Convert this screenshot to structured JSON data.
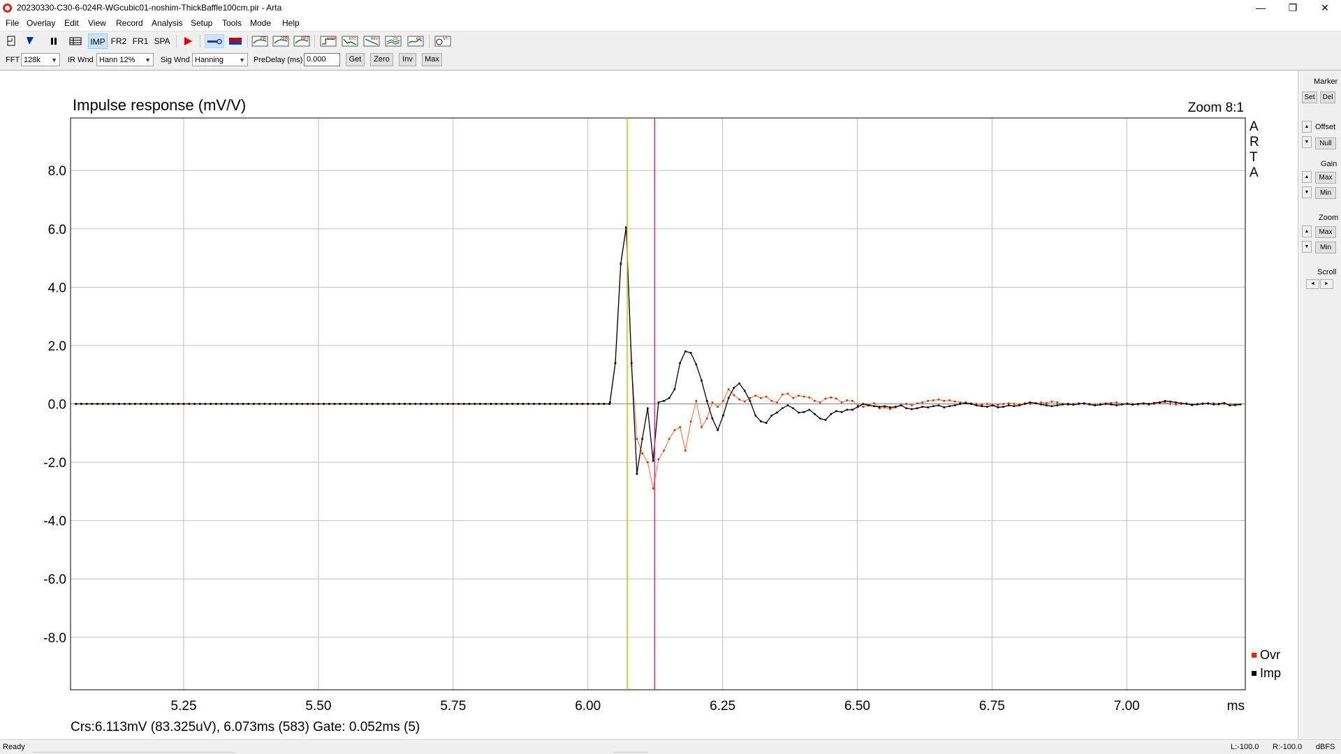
{
  "window": {
    "title": "20230330-C30-6-024R-WGcubic01-noshim-ThickBaffle100cm.pir - Arta",
    "minimize": "—",
    "maximize": "❐",
    "close": "✕"
  },
  "menu": [
    "File",
    "Overlay",
    "Edit",
    "View",
    "Record",
    "Analysis",
    "Setup",
    "Tools",
    "Mode",
    "Help"
  ],
  "toolbar": {
    "modes": [
      "IMP",
      "FR2",
      "FR1",
      "SPA"
    ],
    "active_mode": "IMP",
    "icons": [
      "new-document-icon",
      "open-icon",
      "pause-icon",
      "grid-icon",
      "record-icon",
      "generator-icon",
      "overlay-icon",
      "fr-icon",
      "2fr-icon",
      "rft-icon",
      "step-icon",
      "etc-icon",
      "rev-icon",
      "csd-icon",
      "ed-icon",
      "sti-icon"
    ],
    "mini_labels": [
      "FR",
      "2FR",
      "RFT",
      "STEP",
      "ETC",
      "REV",
      "CS",
      "ED",
      "STI"
    ]
  },
  "options": {
    "fft_label": "FFT",
    "fft_value": "128k",
    "irwnd_label": "IR Wnd",
    "irwnd_value": "Hann 12%",
    "sigwnd_label": "Sig Wnd",
    "sigwnd_value": "Hanning",
    "predelay_label": "PreDelay (ms)",
    "predelay_value": "0.000",
    "buttons": [
      "Get",
      "Zero",
      "Inv",
      "Max"
    ]
  },
  "side_panel": {
    "marker_label": "Marker",
    "set": "Set",
    "del": "Del",
    "offset_label": "Offset",
    "null": "Null",
    "gain_label": "Gain",
    "gain_max": "Max",
    "gain_min": "Min",
    "zoom_label": "Zoom",
    "zoom_max": "Max",
    "zoom_min": "Min",
    "scroll_label": "Scroll",
    "up": "▲",
    "down": "▼",
    "left": "◄",
    "right": "►"
  },
  "status": {
    "left": "Ready",
    "l_level": "L:-100.0",
    "r_level": "R:-100.0",
    "units": "dBFS"
  },
  "chart_data": {
    "type": "line",
    "title": "Impulse response (mV/V)",
    "zoom_text": "Zoom 8:1",
    "watermark": [
      "A",
      "R",
      "T",
      "A"
    ],
    "xlabel": "ms",
    "x_ticks": [
      "5.25",
      "5.50",
      "5.75",
      "6.00",
      "6.25",
      "6.50",
      "6.75",
      "7.00"
    ],
    "y_ticks": [
      "8.0",
      "6.0",
      "4.0",
      "2.0",
      "0.0",
      "-2.0",
      "-4.0",
      "-6.0",
      "-8.0"
    ],
    "xlim": [
      5.04,
      7.22
    ],
    "ylim": [
      -9.8,
      9.8
    ],
    "grid": true,
    "legend_position": "bottom-right",
    "cursor_yellow_x": 6.073,
    "cursor_magenta_x": 6.124,
    "readout": "Crs:6.113mV (83.325uV), 6.073ms (583)  Gate: 0.052ms (5)",
    "series": [
      {
        "name": "Ovr",
        "color": "#e52b00",
        "line_color": "#ff8a5c",
        "x": [
          6.041,
          6.051,
          6.061,
          6.071,
          6.081,
          6.091,
          6.101,
          6.111,
          6.121,
          6.131,
          6.141,
          6.151,
          6.161,
          6.171,
          6.181,
          6.191,
          6.201,
          6.211,
          6.221,
          6.231,
          6.241,
          6.251,
          6.261,
          6.271,
          6.281,
          6.291,
          6.301,
          6.311,
          6.321,
          6.331,
          6.341,
          6.351,
          6.361,
          6.371,
          6.381,
          6.391,
          6.401,
          6.411,
          6.421,
          6.431,
          6.441,
          6.451,
          6.461,
          6.471,
          6.481,
          6.491,
          6.501,
          6.511,
          6.521,
          6.531,
          6.541,
          6.551,
          6.561,
          6.571,
          6.581,
          6.591,
          6.601,
          6.611,
          6.621,
          6.631,
          6.641,
          6.651,
          6.661,
          6.671,
          6.681,
          6.691,
          6.701,
          6.711,
          6.721,
          6.731,
          6.741,
          6.751,
          6.761,
          6.771,
          6.781,
          6.791,
          6.801,
          6.811,
          6.821,
          6.831,
          6.841,
          6.851,
          6.861,
          6.871,
          6.881,
          6.891,
          6.901,
          6.911,
          6.921,
          6.931,
          6.941,
          6.951,
          6.961,
          6.971,
          6.981,
          6.991,
          7.001,
          7.011,
          7.021,
          7.031,
          7.041,
          7.051,
          7.061,
          7.071,
          7.081,
          7.091,
          7.101,
          7.111,
          7.121,
          7.131,
          7.141,
          7.151,
          7.161,
          7.171,
          7.181,
          7.191,
          7.201,
          7.211
        ],
        "values": [
          0.05,
          1.4,
          4.8,
          6.05,
          1.3,
          -1.2,
          -1.7,
          -2.0,
          -2.9,
          -1.9,
          -1.6,
          -1.2,
          -0.9,
          -0.8,
          -1.6,
          -0.6,
          0.1,
          -0.8,
          -0.5,
          0.05,
          -0.1,
          0.1,
          0.5,
          0.3,
          0.15,
          0.08,
          0.2,
          0.28,
          0.2,
          0.25,
          0.1,
          0.05,
          0.32,
          0.35,
          0.2,
          0.28,
          0.25,
          0.22,
          0.1,
          0.05,
          0.18,
          0.22,
          0.18,
          0.05,
          0.12,
          0.1,
          -0.05,
          -0.1,
          -0.05,
          0.02,
          -0.15,
          -0.12,
          -0.18,
          -0.12,
          -0.05,
          0.0,
          -0.05,
          0.02,
          0.05,
          0.1,
          0.12,
          0.15,
          0.1,
          0.12,
          0.08,
          0.05,
          0.05,
          0.02,
          0.0,
          -0.02,
          0.0,
          -0.05,
          -0.04,
          0.0,
          0.02,
          0.0,
          -0.02,
          0.02,
          0.0,
          0.02,
          0.05,
          0.03,
          0.08,
          0.05,
          0.0,
          -0.03,
          0.0,
          0.02,
          0.0,
          0.0,
          -0.02,
          0.0,
          0.02,
          0.03,
          0.05,
          0.0,
          0.02,
          0.0,
          -0.02,
          0.0,
          -0.03,
          0.0,
          0.02,
          0.05,
          0.0,
          -0.02,
          0.0,
          0.02,
          -0.05,
          0.0,
          0.02,
          0.0,
          0.02,
          -0.02,
          0.0,
          -0.03,
          -0.05,
          -0.02
        ]
      },
      {
        "name": "Imp",
        "color": "#000000",
        "line_color": "#000000",
        "x": [
          6.041,
          6.051,
          6.061,
          6.071,
          6.081,
          6.091,
          6.101,
          6.111,
          6.121,
          6.131,
          6.141,
          6.151,
          6.161,
          6.171,
          6.181,
          6.191,
          6.201,
          6.211,
          6.221,
          6.231,
          6.241,
          6.251,
          6.261,
          6.271,
          6.281,
          6.291,
          6.301,
          6.311,
          6.321,
          6.331,
          6.341,
          6.351,
          6.361,
          6.371,
          6.381,
          6.391,
          6.401,
          6.411,
          6.421,
          6.431,
          6.441,
          6.451,
          6.461,
          6.471,
          6.481,
          6.491,
          6.501,
          6.511,
          6.521,
          6.531,
          6.541,
          6.551,
          6.561,
          6.571,
          6.581,
          6.591,
          6.601,
          6.611,
          6.621,
          6.631,
          6.641,
          6.651,
          6.661,
          6.671,
          6.681,
          6.691,
          6.701,
          6.711,
          6.721,
          6.731,
          6.741,
          6.751,
          6.761,
          6.771,
          6.781,
          6.791,
          6.801,
          6.811,
          6.821,
          6.831,
          6.841,
          6.851,
          6.861,
          6.871,
          6.881,
          6.891,
          6.901,
          6.911,
          6.921,
          6.931,
          6.941,
          6.951,
          6.961,
          6.971,
          6.981,
          6.991,
          7.001,
          7.011,
          7.021,
          7.031,
          7.041,
          7.051,
          7.061,
          7.071,
          7.081,
          7.091,
          7.101,
          7.111,
          7.121,
          7.131,
          7.141,
          7.151,
          7.161,
          7.171,
          7.181,
          7.191,
          7.201,
          7.211
        ],
        "values": [
          0.05,
          1.4,
          4.8,
          6.05,
          1.4,
          -2.4,
          -1.2,
          -0.15,
          -1.95,
          0.05,
          0.1,
          0.2,
          0.5,
          1.4,
          1.8,
          1.75,
          1.35,
          0.8,
          0.1,
          -0.5,
          -0.9,
          -0.4,
          0.2,
          0.55,
          0.7,
          0.45,
          0.1,
          -0.4,
          -0.6,
          -0.65,
          -0.4,
          -0.3,
          -0.15,
          -0.05,
          -0.15,
          -0.3,
          -0.28,
          -0.2,
          -0.35,
          -0.5,
          -0.55,
          -0.35,
          -0.25,
          -0.28,
          -0.2,
          -0.2,
          -0.1,
          0.0,
          -0.05,
          -0.08,
          -0.1,
          -0.08,
          -0.12,
          -0.1,
          -0.05,
          -0.15,
          -0.18,
          -0.15,
          -0.1,
          -0.12,
          -0.08,
          -0.05,
          -0.12,
          -0.08,
          -0.05,
          0.0,
          0.02,
          0.0,
          -0.05,
          -0.08,
          -0.1,
          -0.05,
          -0.12,
          -0.1,
          -0.05,
          -0.08,
          -0.05,
          0.0,
          0.05,
          0.02,
          -0.02,
          -0.05,
          -0.08,
          -0.05,
          -0.02,
          0.0,
          -0.03,
          0.0,
          0.02,
          -0.02,
          -0.05,
          -0.03,
          0.0,
          -0.02,
          -0.05,
          -0.02,
          0.0,
          -0.03,
          0.0,
          0.02,
          0.0,
          0.03,
          0.05,
          0.1,
          0.08,
          0.05,
          0.02,
          0.0,
          -0.03,
          -0.02,
          0.0,
          0.02,
          -0.02,
          0.0,
          0.03,
          -0.05,
          -0.03,
          -0.02
        ]
      }
    ],
    "leading_samples": {
      "x_start": 5.05,
      "x_end": 6.041,
      "step": 0.01,
      "value": 0.0
    }
  }
}
